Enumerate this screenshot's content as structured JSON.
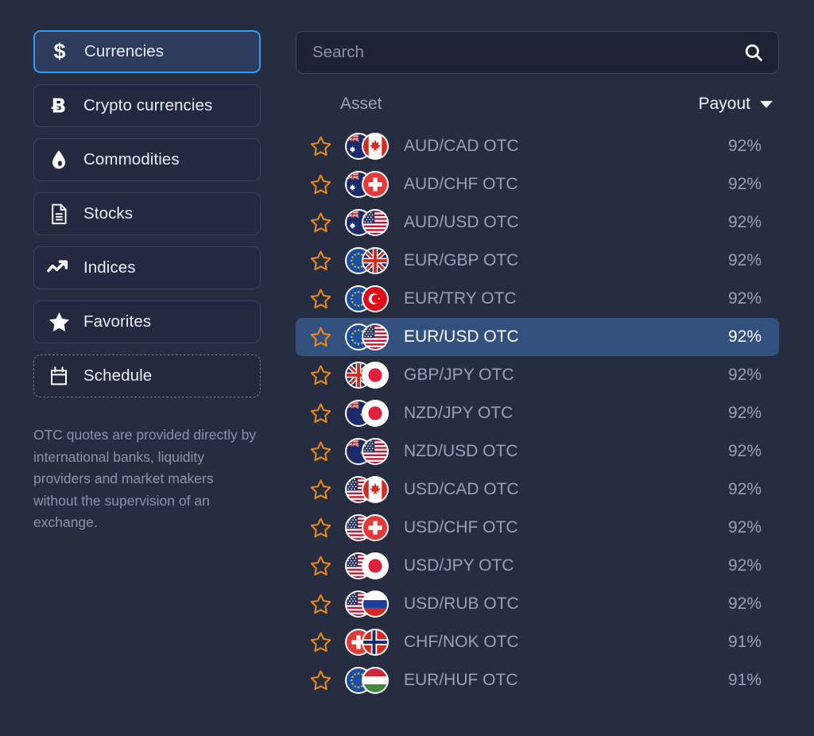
{
  "sidebar": {
    "items": [
      {
        "label": "Currencies",
        "icon": "dollar-icon",
        "active": true,
        "dashed": false
      },
      {
        "label": "Crypto currencies",
        "icon": "bitcoin-icon",
        "active": false,
        "dashed": false
      },
      {
        "label": "Commodities",
        "icon": "droplet-icon",
        "active": false,
        "dashed": false
      },
      {
        "label": "Stocks",
        "icon": "document-icon",
        "active": false,
        "dashed": false
      },
      {
        "label": "Indices",
        "icon": "trend-up-icon",
        "active": false,
        "dashed": false
      },
      {
        "label": "Favorites",
        "icon": "star-filled-icon",
        "active": false,
        "dashed": false
      },
      {
        "label": "Schedule",
        "icon": "calendar-icon",
        "active": false,
        "dashed": true
      }
    ],
    "note": "OTC quotes are provided directly by international banks, liquidity providers and market makers without the supervision of an exchange."
  },
  "search": {
    "placeholder": "Search",
    "value": "",
    "icon": "search-icon"
  },
  "table": {
    "columns": {
      "asset": "Asset",
      "payout": "Payout"
    },
    "sort_icon": "chevron-down-icon",
    "rows": [
      {
        "name": "AUD/CAD OTC",
        "payout": "92%",
        "flag1": "au",
        "flag2": "ca",
        "selected": false,
        "favorite": false
      },
      {
        "name": "AUD/CHF OTC",
        "payout": "92%",
        "flag1": "au",
        "flag2": "ch",
        "selected": false,
        "favorite": false
      },
      {
        "name": "AUD/USD OTC",
        "payout": "92%",
        "flag1": "au",
        "flag2": "us",
        "selected": false,
        "favorite": false
      },
      {
        "name": "EUR/GBP OTC",
        "payout": "92%",
        "flag1": "eu",
        "flag2": "gb",
        "selected": false,
        "favorite": false
      },
      {
        "name": "EUR/TRY OTC",
        "payout": "92%",
        "flag1": "eu",
        "flag2": "tr",
        "selected": false,
        "favorite": false
      },
      {
        "name": "EUR/USD OTC",
        "payout": "92%",
        "flag1": "eu",
        "flag2": "us",
        "selected": true,
        "favorite": false
      },
      {
        "name": "GBP/JPY OTC",
        "payout": "92%",
        "flag1": "gb",
        "flag2": "jp",
        "selected": false,
        "favorite": false
      },
      {
        "name": "NZD/JPY OTC",
        "payout": "92%",
        "flag1": "nz",
        "flag2": "jp",
        "selected": false,
        "favorite": false
      },
      {
        "name": "NZD/USD OTC",
        "payout": "92%",
        "flag1": "nz",
        "flag2": "us",
        "selected": false,
        "favorite": false
      },
      {
        "name": "USD/CAD OTC",
        "payout": "92%",
        "flag1": "us",
        "flag2": "ca",
        "selected": false,
        "favorite": false
      },
      {
        "name": "USD/CHF OTC",
        "payout": "92%",
        "flag1": "us",
        "flag2": "ch",
        "selected": false,
        "favorite": false
      },
      {
        "name": "USD/JPY OTC",
        "payout": "92%",
        "flag1": "us",
        "flag2": "jp",
        "selected": false,
        "favorite": false
      },
      {
        "name": "USD/RUB OTC",
        "payout": "92%",
        "flag1": "us",
        "flag2": "ru",
        "selected": false,
        "favorite": false
      },
      {
        "name": "CHF/NOK OTC",
        "payout": "91%",
        "flag1": "ch",
        "flag2": "no",
        "selected": false,
        "favorite": false
      },
      {
        "name": "EUR/HUF OTC",
        "payout": "91%",
        "flag1": "eu",
        "flag2": "hu",
        "selected": false,
        "favorite": false
      }
    ]
  },
  "colors": {
    "background": "#262d41",
    "panel": "#222941",
    "accent": "#2f9bf5",
    "selected_row": "#33517f",
    "star": "#e8871e",
    "text_muted": "#97a1b6",
    "text_bright": "#ffffff"
  }
}
